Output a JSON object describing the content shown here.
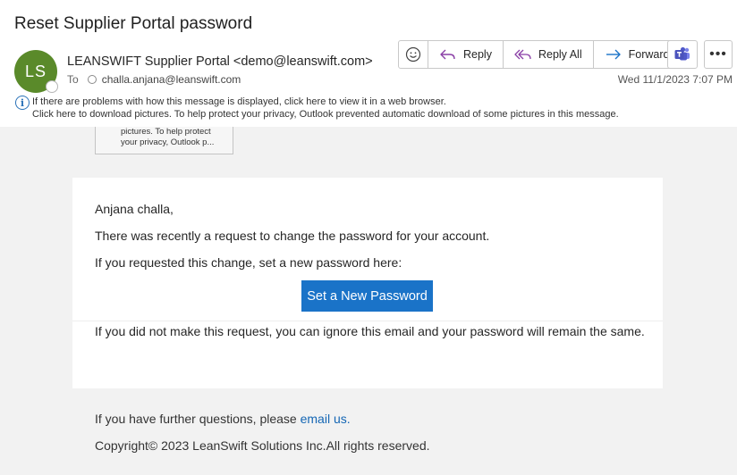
{
  "email": {
    "subject": "Reset Supplier Portal password",
    "avatar_initials": "LS",
    "sender": "LEANSWIFT Supplier Portal <demo@leanswift.com>",
    "to_label": "To",
    "recipient": "challa.anjana@leanswift.com",
    "date": "Wed 11/1/2023 7:07 PM"
  },
  "toolbar": {
    "reply": "Reply",
    "reply_all": "Reply All",
    "forward": "Forward",
    "more": "•••"
  },
  "infobar": {
    "line1": "If there are problems with how this message is displayed, click here to view it in a web browser.",
    "line2": "Click here to download pictures. To help protect your privacy, Outlook prevented automatic download of some pictures in this message."
  },
  "placeholder_image": {
    "line1": "pictures. To help protect",
    "line2": "your privacy, Outlook p..."
  },
  "body": {
    "greeting": "Anjana challa,",
    "line1": "There was recently a request to change the password for your account.",
    "line2": "If you requested this change, set a new password here:",
    "button_label": "Set a New Password",
    "line3": "If you did not make this request, you can ignore this email and your password will remain the same."
  },
  "footer": {
    "questions_prefix": "If you have further questions, please ",
    "email_link": "email us.",
    "copyright": "Copyright© 2023 LeanSwift Solutions Inc.All rights reserved."
  },
  "colors": {
    "avatar": "#5a8a2a",
    "accent": "#1a73c8",
    "link": "#1466b4",
    "reply_icon": "#8a3fa6",
    "forward_icon": "#1a73c8",
    "teams": "#4b53bc"
  },
  "icons": [
    "emoji-icon",
    "reply-icon",
    "reply-all-icon",
    "forward-icon",
    "teams-icon",
    "more-icon",
    "info-icon"
  ]
}
